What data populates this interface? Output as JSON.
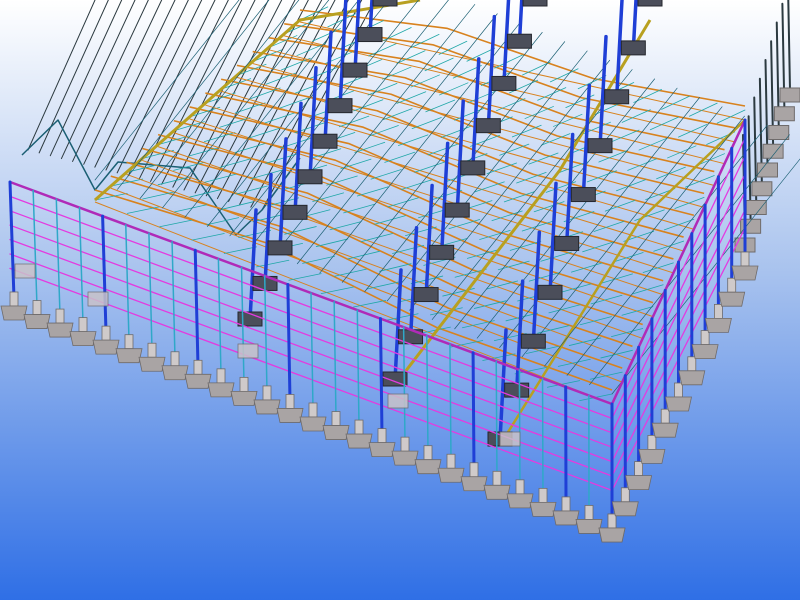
{
  "viewport": {
    "background_top": "#ffffff",
    "background_mid": "#a9c3ee",
    "background_bottom": "#2f6fe6"
  },
  "colors": {
    "column": "#1f3fd6",
    "column_light": "#2fa8c8",
    "girt": "#e43ae0",
    "girt_dark": "#b02ab8",
    "truss_top": "#d8821e",
    "truss_web": "#1fa7a7",
    "purlin": "#1b5f73",
    "ridge": "#b8a020",
    "roof_line": "#2c3a40",
    "footing": "#a9a4a4",
    "footing_dark": "#6f6b6b",
    "footing_light": "#cfcaca",
    "base_plate": "#c9c2c9"
  }
}
